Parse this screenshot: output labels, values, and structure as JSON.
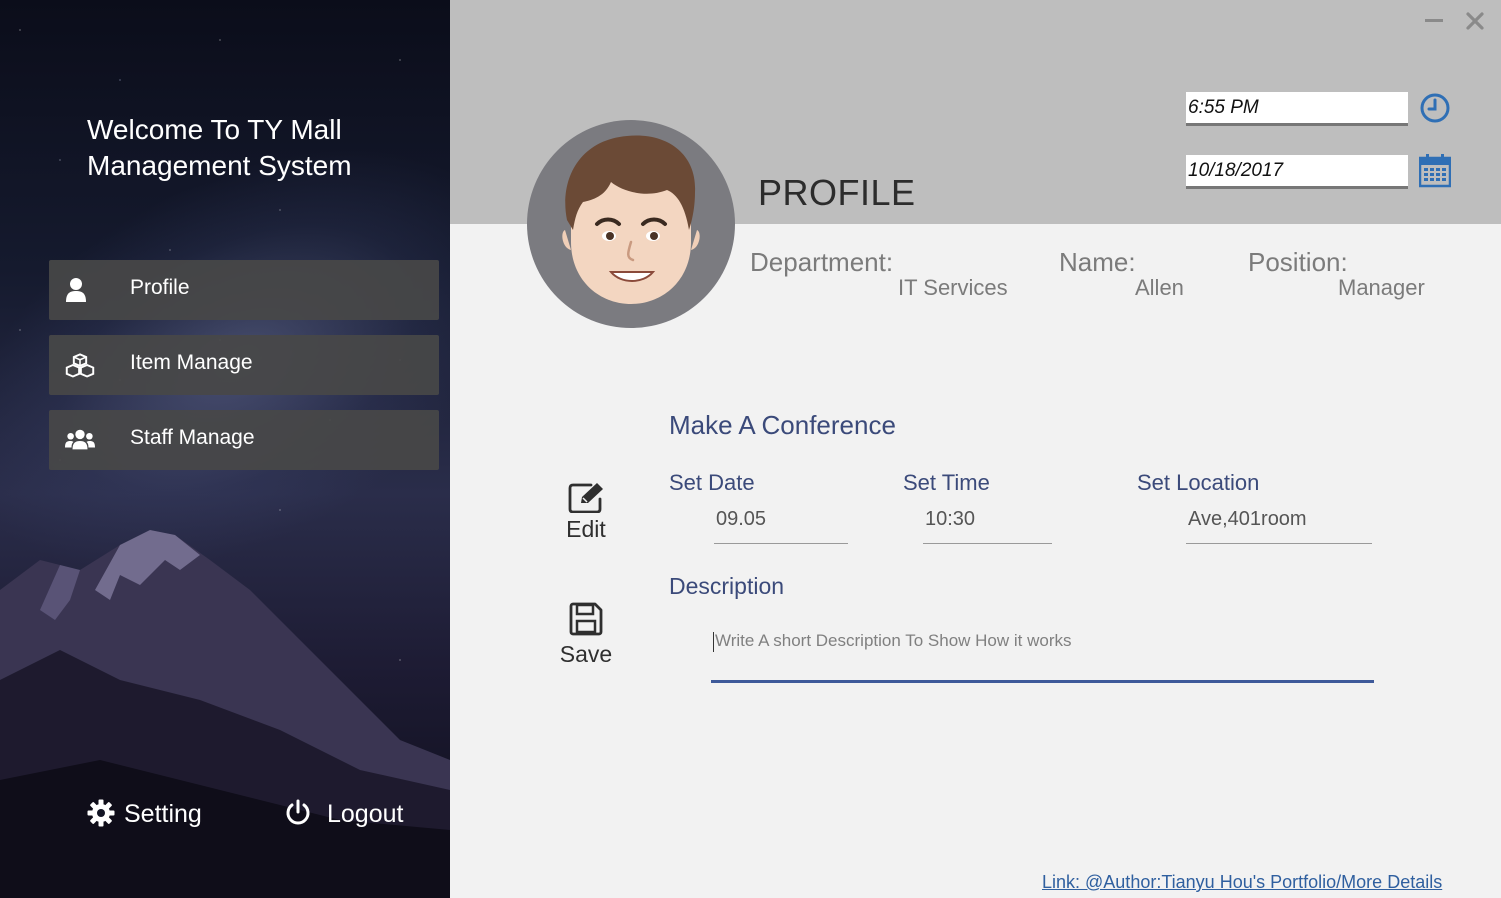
{
  "sidebar": {
    "welcome_line1": "Welcome To TY Mall",
    "welcome_line2": "Management System",
    "nav": [
      {
        "label": "Profile",
        "icon": "user-icon"
      },
      {
        "label": "Item Manage",
        "icon": "cubes-icon"
      },
      {
        "label": "Staff Manage",
        "icon": "users-icon"
      }
    ],
    "setting_label": "Setting",
    "logout_label": "Logout"
  },
  "header": {
    "title": "PROFILE",
    "time_value": "6:55 PM",
    "date_value": "10/18/2017"
  },
  "profile": {
    "department_label": "Department:",
    "department_value": "IT Services",
    "name_label": "Name:",
    "name_value": "Allen",
    "position_label": "Position:",
    "position_value": "Manager"
  },
  "conference": {
    "title": "Make A Conference",
    "set_date_label": "Set Date",
    "set_time_label": "Set Time",
    "set_location_label": "Set Location",
    "set_date_value": "09.05",
    "set_time_value": "10:30",
    "set_location_value": "Ave,401room",
    "description_label": "Description",
    "description_placeholder": "Write A short Description To Show How it works"
  },
  "actions": {
    "edit_label": "Edit",
    "save_label": "Save"
  },
  "footer": {
    "link_text": "Link: @Author:Tianyu Hou's Portfolio/More Details"
  },
  "colors": {
    "accent_blue": "#2f6fb5",
    "label_blue": "#3b4a7a",
    "header_gray": "#bebebe",
    "nav_bg": "#484848",
    "sidebar_dark": "#151a2e"
  }
}
